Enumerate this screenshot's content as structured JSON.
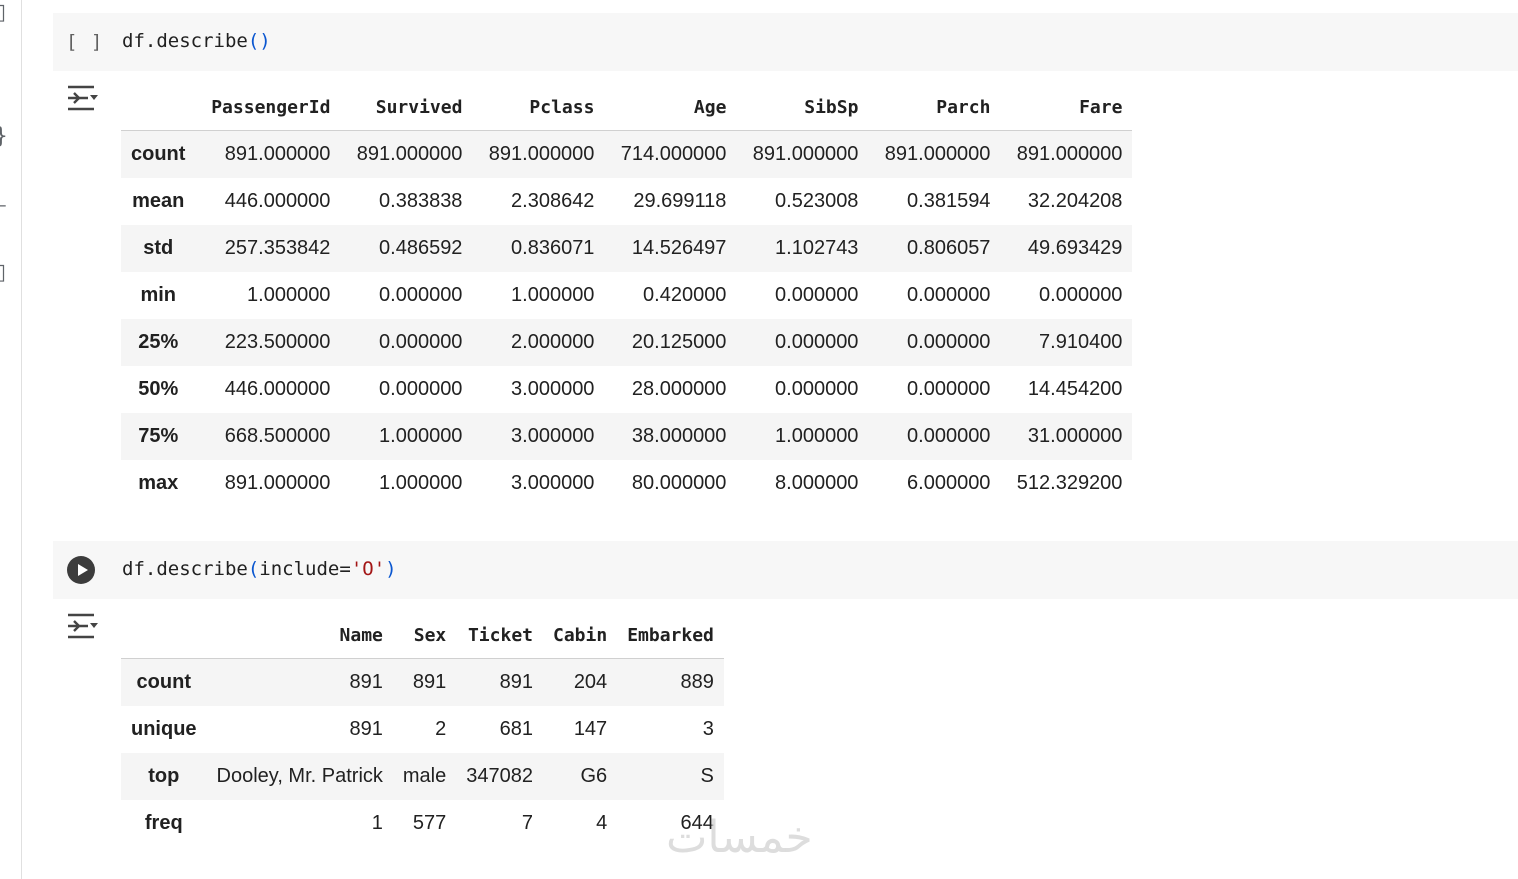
{
  "gutter": {
    "icons": [
      "bracket-icon",
      "chevron-right-icon",
      "curly-brace-icon",
      "key-icon",
      "folder-icon"
    ]
  },
  "cell1": {
    "exec_count": "[ ]",
    "code_prefix": "df.describe",
    "code_open": "(",
    "code_close": ")",
    "table": {
      "columns": [
        "PassengerId",
        "Survived",
        "Pclass",
        "Age",
        "SibSp",
        "Parch",
        "Fare"
      ],
      "rows": [
        {
          "label": "count",
          "cells": [
            "891.000000",
            "891.000000",
            "891.000000",
            "714.000000",
            "891.000000",
            "891.000000",
            "891.000000"
          ]
        },
        {
          "label": "mean",
          "cells": [
            "446.000000",
            "0.383838",
            "2.308642",
            "29.699118",
            "0.523008",
            "0.381594",
            "32.204208"
          ]
        },
        {
          "label": "std",
          "cells": [
            "257.353842",
            "0.486592",
            "0.836071",
            "14.526497",
            "1.102743",
            "0.806057",
            "49.693429"
          ]
        },
        {
          "label": "min",
          "cells": [
            "1.000000",
            "0.000000",
            "1.000000",
            "0.420000",
            "0.000000",
            "0.000000",
            "0.000000"
          ]
        },
        {
          "label": "25%",
          "cells": [
            "223.500000",
            "0.000000",
            "2.000000",
            "20.125000",
            "0.000000",
            "0.000000",
            "7.910400"
          ]
        },
        {
          "label": "50%",
          "cells": [
            "446.000000",
            "0.000000",
            "3.000000",
            "28.000000",
            "0.000000",
            "0.000000",
            "14.454200"
          ]
        },
        {
          "label": "75%",
          "cells": [
            "668.500000",
            "1.000000",
            "3.000000",
            "38.000000",
            "1.000000",
            "0.000000",
            "31.000000"
          ]
        },
        {
          "label": "max",
          "cells": [
            "891.000000",
            "1.000000",
            "3.000000",
            "80.000000",
            "8.000000",
            "6.000000",
            "512.329200"
          ]
        }
      ]
    }
  },
  "cell2": {
    "code_prefix": "df.describe",
    "code_open": "(",
    "code_arg": "include=",
    "code_str": "'O'",
    "code_close": ")",
    "table": {
      "columns": [
        "Name",
        "Sex",
        "Ticket",
        "Cabin",
        "Embarked"
      ],
      "rows": [
        {
          "label": "count",
          "cells": [
            "891",
            "891",
            "891",
            "204",
            "889"
          ]
        },
        {
          "label": "unique",
          "cells": [
            "891",
            "2",
            "681",
            "147",
            "3"
          ]
        },
        {
          "label": "top",
          "cells": [
            "Dooley, Mr. Patrick",
            "male",
            "347082",
            "G6",
            "S"
          ]
        },
        {
          "label": "freq",
          "cells": [
            "1",
            "577",
            "7",
            "4",
            "644"
          ]
        }
      ]
    }
  },
  "watermark": "خمسات"
}
